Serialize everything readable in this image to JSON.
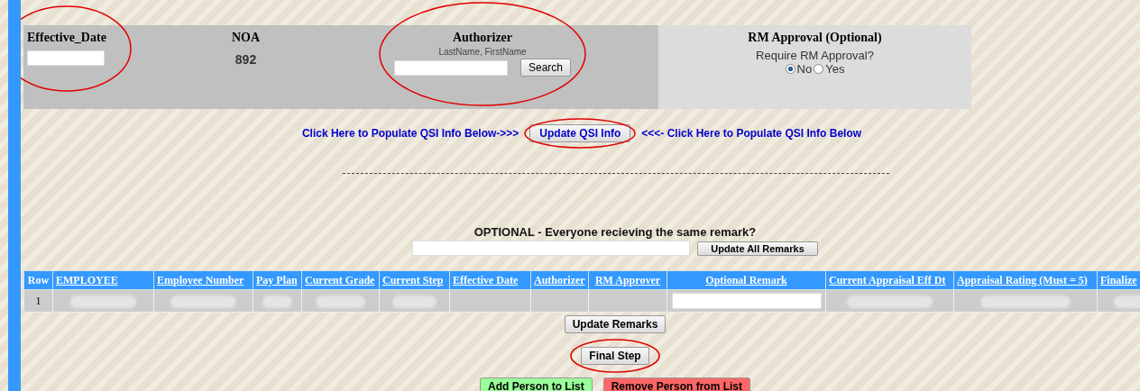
{
  "top_panel": {
    "effective_date": {
      "label": "Effective_Date",
      "circled": true
    },
    "noa": {
      "label": "NOA",
      "value": "892"
    },
    "authorizer": {
      "label": "Authorizer",
      "hint": "LastName, FirstName",
      "button": "Search",
      "circled": true
    },
    "rm_approval": {
      "label": "RM Approval (Optional)",
      "question": "Require RM Approval?",
      "options": [
        {
          "label": "No",
          "selected": true
        },
        {
          "label": "Yes",
          "selected": false
        }
      ]
    }
  },
  "qsi": {
    "left_text": "Click Here to Populate QSI Info Below->>>",
    "button": "Update QSI Info",
    "button_circled": true,
    "right_text": "<<<- Click Here to Populate QSI Info Below"
  },
  "remark_all": {
    "question": "OPTIONAL - Everyone recieving the same remark?",
    "button": "Update All Remarks"
  },
  "table": {
    "columns": [
      "Row",
      "EMPLOYEE",
      "Employee Number",
      "Pay Plan",
      "Current Grade",
      "Current Step",
      "Effective  Date",
      "Authorizer",
      "RM Approver",
      "Optional Remark",
      "Current Appraisal Eff Dt",
      "Appraisal Rating (Must = 5)",
      "Finalize"
    ],
    "rows": [
      {
        "cells": [
          {
            "kind": "text",
            "text": "1"
          },
          {
            "kind": "redacted"
          },
          {
            "kind": "redacted"
          },
          {
            "kind": "redacted"
          },
          {
            "kind": "redacted"
          },
          {
            "kind": "redacted"
          },
          {
            "kind": "empty"
          },
          {
            "kind": "empty"
          },
          {
            "kind": "empty"
          },
          {
            "kind": "input"
          },
          {
            "kind": "redacted"
          },
          {
            "kind": "redacted"
          },
          {
            "kind": "redacted"
          }
        ]
      }
    ]
  },
  "update_remarks": {
    "label": "Update Remarks"
  },
  "final_step": {
    "label": "Final Step",
    "circled": true
  },
  "list_buttons": [
    {
      "label": "Add Person to List",
      "color": "#99ff99"
    },
    {
      "label": "Remove Person from List",
      "color": "#ff6666"
    }
  ]
}
